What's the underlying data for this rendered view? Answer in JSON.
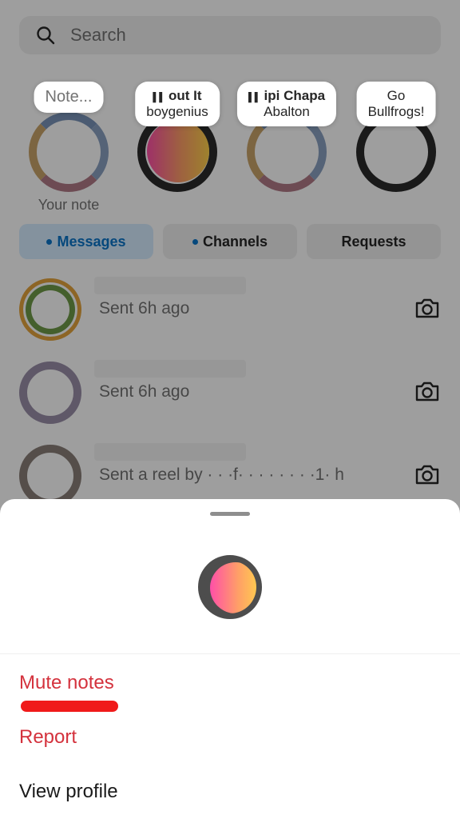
{
  "search": {
    "placeholder": "Search"
  },
  "notes": [
    {
      "bubble_line1": "Note...",
      "bubble_line2": "",
      "caption": "Your note"
    },
    {
      "bubble_line1": "out It",
      "bubble_line2": "boygenius",
      "caption": ""
    },
    {
      "bubble_line1": "ipi Chapa",
      "bubble_line2": "Abalton",
      "caption": ""
    },
    {
      "bubble_line1": "Go",
      "bubble_line2": "Bullfrogs!",
      "caption": ""
    }
  ],
  "tabs": [
    {
      "label": "Messages",
      "active": true
    },
    {
      "label": "Channels",
      "active": false
    },
    {
      "label": "Requests",
      "active": false
    }
  ],
  "chats": [
    {
      "preview": "Sent 6h ago"
    },
    {
      "preview": "Sent 6h ago"
    },
    {
      "preview": "Sent a reel by ·  · ·f·  · ·  · ·  · ·  ·1·  h"
    }
  ],
  "sheet": {
    "options": [
      {
        "label": "Mute notes"
      },
      {
        "label": "Report"
      },
      {
        "label": "View profile"
      }
    ]
  },
  "colors": {
    "destructive": "#d4323d",
    "accent_blue": "#0a74c9",
    "annotation_underline": "#f01a1a"
  }
}
